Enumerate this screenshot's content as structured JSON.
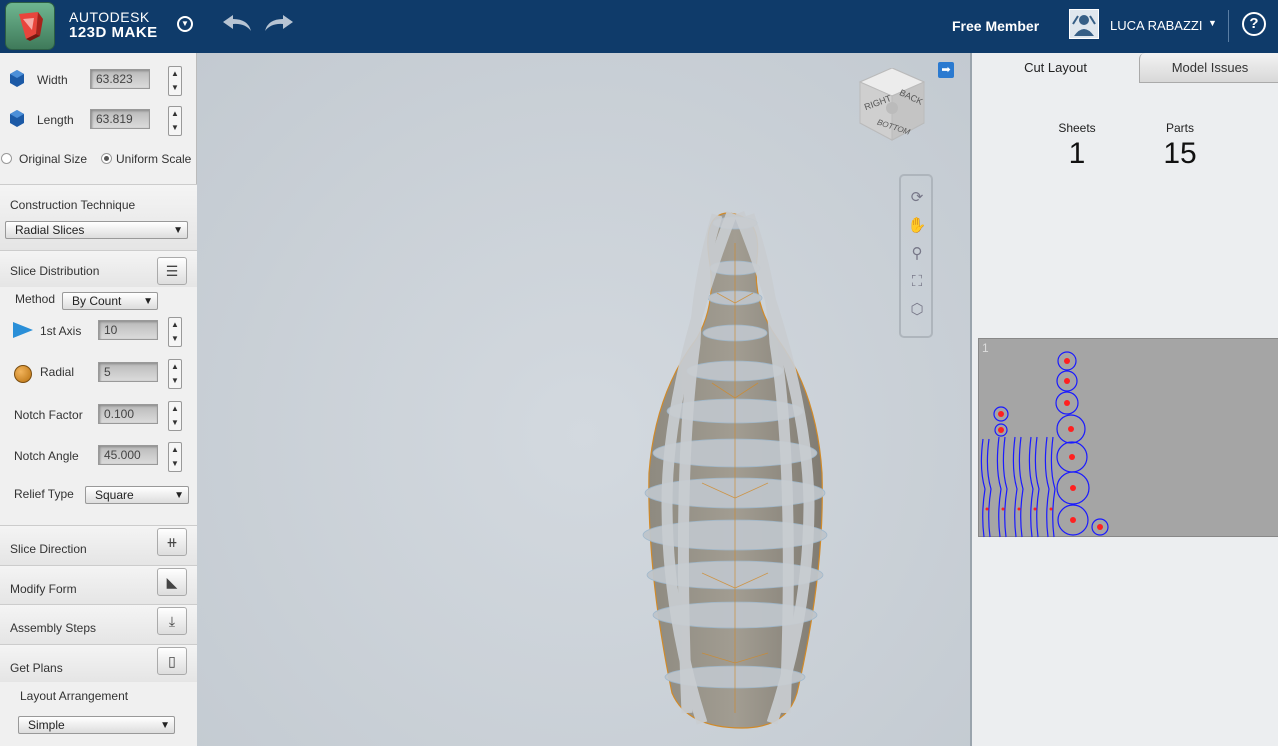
{
  "header": {
    "brand_line1": "AUTODESK",
    "brand_line2": "123D MAKE",
    "membership": "Free Member",
    "user_name": "LUCA RABAZZI",
    "help": "?"
  },
  "size": {
    "width_label": "Width",
    "width_value": "63.823",
    "length_label": "Length",
    "length_value": "63.819",
    "original_size": "Original Size",
    "uniform_scale": "Uniform Scale"
  },
  "construction": {
    "title": "Construction Technique",
    "value": "Radial Slices"
  },
  "slice_distribution": {
    "title": "Slice Distribution",
    "method_label": "Method",
    "method_value": "By Count",
    "axis1_label": "1st Axis",
    "axis1_value": "10",
    "radial_label": "Radial",
    "radial_value": "5",
    "notch_factor_label": "Notch Factor",
    "notch_factor_value": "0.100",
    "notch_angle_label": "Notch Angle",
    "notch_angle_value": "45.000",
    "relief_label": "Relief Type",
    "relief_value": "Square"
  },
  "sections": {
    "slice_direction": "Slice Direction",
    "modify_form": "Modify Form",
    "assembly_steps": "Assembly Steps",
    "get_plans": "Get Plans",
    "layout_arrangement": "Layout Arrangement",
    "layout_value": "Simple"
  },
  "viewcube": {
    "right": "RIGHT",
    "back": "BACK",
    "bottom": "BOTTOM"
  },
  "right_panel": {
    "tab_cut_layout": "Cut Layout",
    "tab_model_issues": "Model Issues",
    "sheets_label": "Sheets",
    "sheets_value": "1",
    "parts_label": "Parts",
    "parts_value": "15",
    "sheet_number": "1"
  },
  "colors": {
    "header_bg": "#0f3b6a",
    "model_edge": "#d08a2a",
    "layout_blue": "#1a1aff",
    "layout_red": "#ff2020"
  }
}
